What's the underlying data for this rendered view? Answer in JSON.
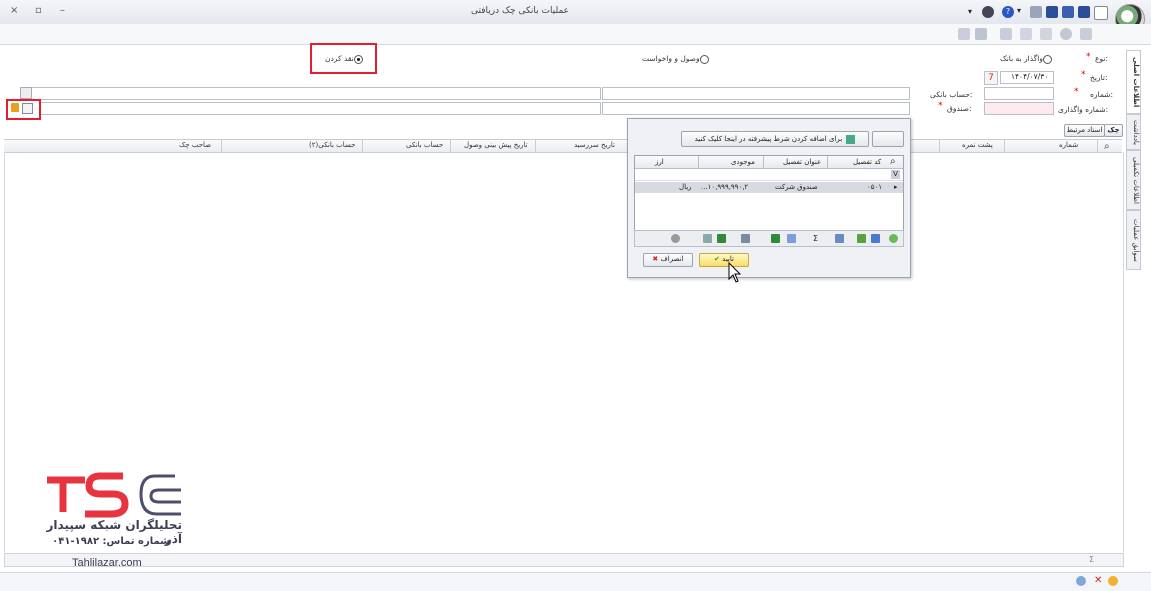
{
  "window": {
    "title": "عملیات بانکی چک دریافتی",
    "close_glyph": "×",
    "max_glyph": "▫",
    "min_glyph": "–",
    "help_glyph": "?",
    "menu_glyph": "▾"
  },
  "side_tabs": [
    "اطلاعات اصلی",
    "یادداشت",
    "اطلاعات تکمیلی",
    "سوابق عملیات"
  ],
  "form": {
    "type_label": "نوع:",
    "radio_bank_deposit": "واگذار به بانک",
    "radio_collect": "وصول و واخواست",
    "radio_cash": "نقد کردن",
    "date_label": "تاریخ:",
    "date_value": "۱۴۰۴/۰۷/۳۰",
    "number_label": "شماره:",
    "assign_number_label": "شماره واگذاری:",
    "bank_account_label": "حساب بانکی:",
    "cash_box_label": "صندوق:",
    "required_mark": "*"
  },
  "tabs_strip": {
    "check": "چک",
    "related_docs": "اسناد مرتبط"
  },
  "grid": {
    "columns": [
      "شماره",
      "پشت نمره",
      "تاریخ سررسید",
      "تاریخ پیش بینی وصول",
      "حساب بانکی",
      "حساب بانکی(۲)",
      "صاحب چک"
    ]
  },
  "popup": {
    "filter_hint": "برای اضافه کردن شرط پیشرفته در اینجا کلیک کنید",
    "columns": [
      "کد تفصیل",
      "عنوان تفصیل",
      "موجودی",
      "ارز"
    ],
    "rows": [
      {
        "code": "۰۵۰۱",
        "title": "صندوق شرکت",
        "balance": "...۱۰,۹۹۹,۹۹۰,۲",
        "currency": "ریال"
      }
    ],
    "ok_label": "تایید",
    "cancel_label": "انصراف"
  },
  "footer": {
    "sum_glyph": "Σ"
  },
  "brand": {
    "line1": "تحلیلگران شبکه سپیدار آذر",
    "line2": "شماره تماس: ۱۹۸۲-۰۴۱",
    "website": "Tahlilazar.com"
  },
  "colors": {
    "accent_red": "#e0202e",
    "brand_red": "#e8343f",
    "selection_grey": "#d7dae0"
  }
}
